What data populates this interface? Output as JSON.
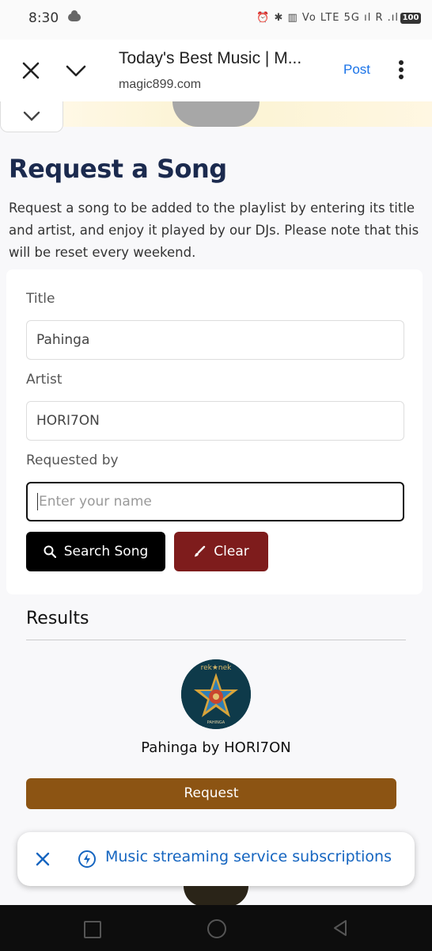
{
  "status_bar": {
    "time": "8:30",
    "icons_text": "⏰ ✱ ▥ Vo LTE 5G ıl R .ıl",
    "battery": "100"
  },
  "browser": {
    "title": "Today's Best Music | M...",
    "url": "magic899.com",
    "post_label": "Post"
  },
  "content": {
    "heading": "Request a Song",
    "intro": "Request a song to be added to the playlist by entering its title and artist, and enjoy it played by our DJs. Please note that this will be reset every weekend."
  },
  "form": {
    "title_label": "Title",
    "title_value": "Pahinga",
    "artist_label": "Artist",
    "artist_value": "HORI7ON",
    "requested_by_label": "Requested by",
    "requested_by_placeholder": "Enter your name",
    "search_button": "Search Song",
    "clear_button": "Clear"
  },
  "results": {
    "title": "Results",
    "album_logo_text": "rek★nek",
    "album_caption": "PAHINGA",
    "song_line": "Pahinga by HORI7ON",
    "request_button": "Request"
  },
  "snackbar": {
    "text": "Music streaming service subscriptions"
  },
  "colors": {
    "heading": "#1b2a4e",
    "clear_button": "#7e1c1c",
    "request_button": "#8c5413",
    "link_blue": "#1565c0"
  }
}
